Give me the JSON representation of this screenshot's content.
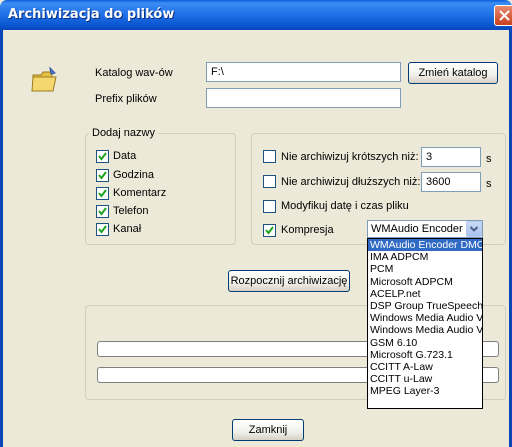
{
  "window": {
    "title": "Archiwizacja do plików"
  },
  "form": {
    "catalog_label": "Katalog wav-ów",
    "catalog_value": "F:\\",
    "change_catalog_button": "Zmień katalog",
    "prefix_label": "Prefix plików",
    "prefix_value": ""
  },
  "names_group": {
    "title": "Dodaj nazwy",
    "items": [
      {
        "label": "Data",
        "checked": true
      },
      {
        "label": "Godzina",
        "checked": true
      },
      {
        "label": "Komentarz",
        "checked": true
      },
      {
        "label": "Telefon",
        "checked": true
      },
      {
        "label": "Kanał",
        "checked": true
      }
    ]
  },
  "options": {
    "shorter_label": "Nie archiwizuj krótszych niż:",
    "shorter_value": "3",
    "shorter_unit": "s",
    "longer_label": "Nie archiwizuj dłuższych niż:",
    "longer_value": "3600",
    "longer_unit": "s",
    "modify_label": "Modyfikuj datę i czas pliku",
    "compress_label": "Kompresja",
    "compress_selected": "WMAudio Encoder DM",
    "codec_options": [
      "WMAudio Encoder DMO",
      "IMA ADPCM",
      "PCM",
      "Microsoft ADPCM",
      "ACELP.net",
      "DSP Group TrueSpeech",
      "Windows Media Audio V",
      "Windows Media Audio V",
      "GSM 6.10",
      "Microsoft G.723.1",
      "CCITT A-Law",
      "CCITT u-Law",
      "MPEG Layer-3"
    ]
  },
  "start_button": "Rozpocznij archiwizację",
  "close_button": "Zamknij",
  "colors": {
    "title_bar": "#0a5fd8",
    "face": "#ece9d8",
    "selection": "#316ac5"
  }
}
